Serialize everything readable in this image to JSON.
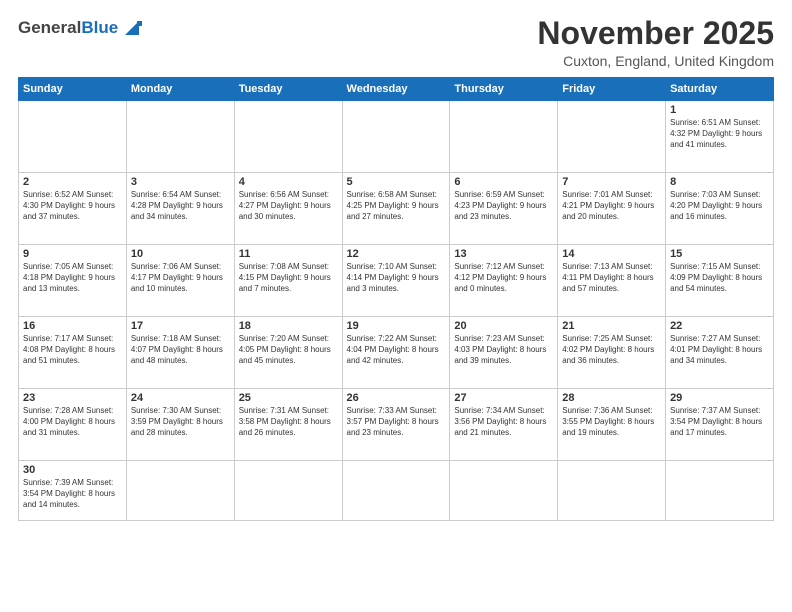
{
  "header": {
    "logo_general": "General",
    "logo_blue": "Blue",
    "month_year": "November 2025",
    "location": "Cuxton, England, United Kingdom"
  },
  "days_of_week": [
    "Sunday",
    "Monday",
    "Tuesday",
    "Wednesday",
    "Thursday",
    "Friday",
    "Saturday"
  ],
  "weeks": [
    [
      {
        "day": "",
        "info": ""
      },
      {
        "day": "",
        "info": ""
      },
      {
        "day": "",
        "info": ""
      },
      {
        "day": "",
        "info": ""
      },
      {
        "day": "",
        "info": ""
      },
      {
        "day": "",
        "info": ""
      },
      {
        "day": "1",
        "info": "Sunrise: 6:51 AM\nSunset: 4:32 PM\nDaylight: 9 hours\nand 41 minutes."
      }
    ],
    [
      {
        "day": "2",
        "info": "Sunrise: 6:52 AM\nSunset: 4:30 PM\nDaylight: 9 hours\nand 37 minutes."
      },
      {
        "day": "3",
        "info": "Sunrise: 6:54 AM\nSunset: 4:28 PM\nDaylight: 9 hours\nand 34 minutes."
      },
      {
        "day": "4",
        "info": "Sunrise: 6:56 AM\nSunset: 4:27 PM\nDaylight: 9 hours\nand 30 minutes."
      },
      {
        "day": "5",
        "info": "Sunrise: 6:58 AM\nSunset: 4:25 PM\nDaylight: 9 hours\nand 27 minutes."
      },
      {
        "day": "6",
        "info": "Sunrise: 6:59 AM\nSunset: 4:23 PM\nDaylight: 9 hours\nand 23 minutes."
      },
      {
        "day": "7",
        "info": "Sunrise: 7:01 AM\nSunset: 4:21 PM\nDaylight: 9 hours\nand 20 minutes."
      },
      {
        "day": "8",
        "info": "Sunrise: 7:03 AM\nSunset: 4:20 PM\nDaylight: 9 hours\nand 16 minutes."
      }
    ],
    [
      {
        "day": "9",
        "info": "Sunrise: 7:05 AM\nSunset: 4:18 PM\nDaylight: 9 hours\nand 13 minutes."
      },
      {
        "day": "10",
        "info": "Sunrise: 7:06 AM\nSunset: 4:17 PM\nDaylight: 9 hours\nand 10 minutes."
      },
      {
        "day": "11",
        "info": "Sunrise: 7:08 AM\nSunset: 4:15 PM\nDaylight: 9 hours\nand 7 minutes."
      },
      {
        "day": "12",
        "info": "Sunrise: 7:10 AM\nSunset: 4:14 PM\nDaylight: 9 hours\nand 3 minutes."
      },
      {
        "day": "13",
        "info": "Sunrise: 7:12 AM\nSunset: 4:12 PM\nDaylight: 9 hours\nand 0 minutes."
      },
      {
        "day": "14",
        "info": "Sunrise: 7:13 AM\nSunset: 4:11 PM\nDaylight: 8 hours\nand 57 minutes."
      },
      {
        "day": "15",
        "info": "Sunrise: 7:15 AM\nSunset: 4:09 PM\nDaylight: 8 hours\nand 54 minutes."
      }
    ],
    [
      {
        "day": "16",
        "info": "Sunrise: 7:17 AM\nSunset: 4:08 PM\nDaylight: 8 hours\nand 51 minutes."
      },
      {
        "day": "17",
        "info": "Sunrise: 7:18 AM\nSunset: 4:07 PM\nDaylight: 8 hours\nand 48 minutes."
      },
      {
        "day": "18",
        "info": "Sunrise: 7:20 AM\nSunset: 4:05 PM\nDaylight: 8 hours\nand 45 minutes."
      },
      {
        "day": "19",
        "info": "Sunrise: 7:22 AM\nSunset: 4:04 PM\nDaylight: 8 hours\nand 42 minutes."
      },
      {
        "day": "20",
        "info": "Sunrise: 7:23 AM\nSunset: 4:03 PM\nDaylight: 8 hours\nand 39 minutes."
      },
      {
        "day": "21",
        "info": "Sunrise: 7:25 AM\nSunset: 4:02 PM\nDaylight: 8 hours\nand 36 minutes."
      },
      {
        "day": "22",
        "info": "Sunrise: 7:27 AM\nSunset: 4:01 PM\nDaylight: 8 hours\nand 34 minutes."
      }
    ],
    [
      {
        "day": "23",
        "info": "Sunrise: 7:28 AM\nSunset: 4:00 PM\nDaylight: 8 hours\nand 31 minutes."
      },
      {
        "day": "24",
        "info": "Sunrise: 7:30 AM\nSunset: 3:59 PM\nDaylight: 8 hours\nand 28 minutes."
      },
      {
        "day": "25",
        "info": "Sunrise: 7:31 AM\nSunset: 3:58 PM\nDaylight: 8 hours\nand 26 minutes."
      },
      {
        "day": "26",
        "info": "Sunrise: 7:33 AM\nSunset: 3:57 PM\nDaylight: 8 hours\nand 23 minutes."
      },
      {
        "day": "27",
        "info": "Sunrise: 7:34 AM\nSunset: 3:56 PM\nDaylight: 8 hours\nand 21 minutes."
      },
      {
        "day": "28",
        "info": "Sunrise: 7:36 AM\nSunset: 3:55 PM\nDaylight: 8 hours\nand 19 minutes."
      },
      {
        "day": "29",
        "info": "Sunrise: 7:37 AM\nSunset: 3:54 PM\nDaylight: 8 hours\nand 17 minutes."
      }
    ],
    [
      {
        "day": "30",
        "info": "Sunrise: 7:39 AM\nSunset: 3:54 PM\nDaylight: 8 hours\nand 14 minutes."
      },
      {
        "day": "",
        "info": ""
      },
      {
        "day": "",
        "info": ""
      },
      {
        "day": "",
        "info": ""
      },
      {
        "day": "",
        "info": ""
      },
      {
        "day": "",
        "info": ""
      },
      {
        "day": "",
        "info": ""
      }
    ]
  ]
}
